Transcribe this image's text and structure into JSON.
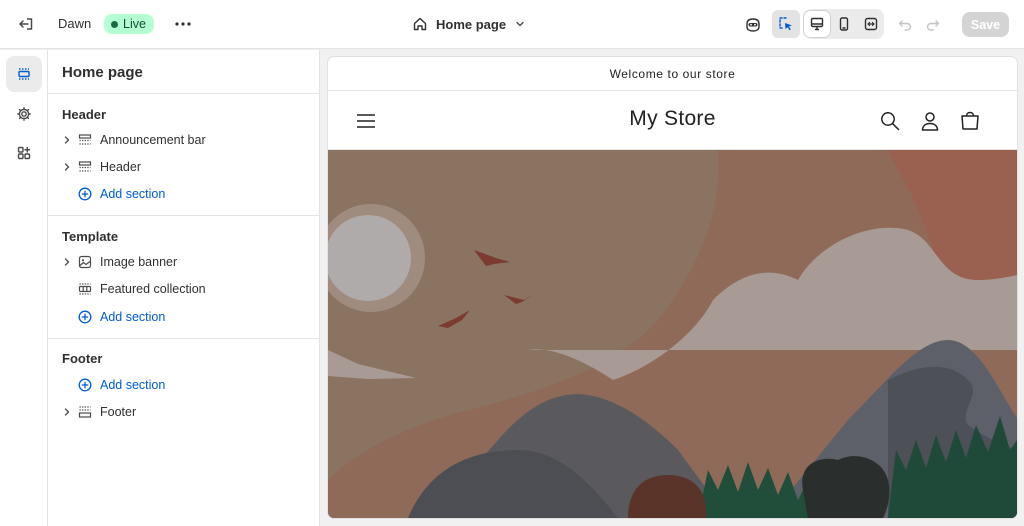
{
  "topbar": {
    "exit_icon": "exit-icon",
    "theme_name": "Dawn",
    "status_badge": "Live",
    "more_icon": "more-horizontal-icon",
    "page_selector": "Home page",
    "save_label": "Save"
  },
  "rail": {
    "items": [
      "sections-icon",
      "settings-gear-icon",
      "apps-icon"
    ]
  },
  "panel": {
    "title": "Home page",
    "groups": [
      {
        "title": "Header",
        "items": [
          {
            "label": "Announcement bar",
            "expandable": true
          },
          {
            "label": "Header",
            "expandable": true
          }
        ],
        "add_label": "Add section"
      },
      {
        "title": "Template",
        "items": [
          {
            "label": "Image banner",
            "expandable": true
          },
          {
            "label": "Featured collection",
            "expandable": false
          }
        ],
        "add_label": "Add section"
      },
      {
        "title": "Footer",
        "add_label": "Add section",
        "items": [
          {
            "label": "Footer",
            "expandable": true
          }
        ]
      }
    ]
  },
  "preview": {
    "announcement": "Welcome to our store",
    "store_name": "My Store"
  },
  "colors": {
    "accent": "#005bd3",
    "live_bg": "#b4fed2",
    "live_text": "#0c5132"
  }
}
